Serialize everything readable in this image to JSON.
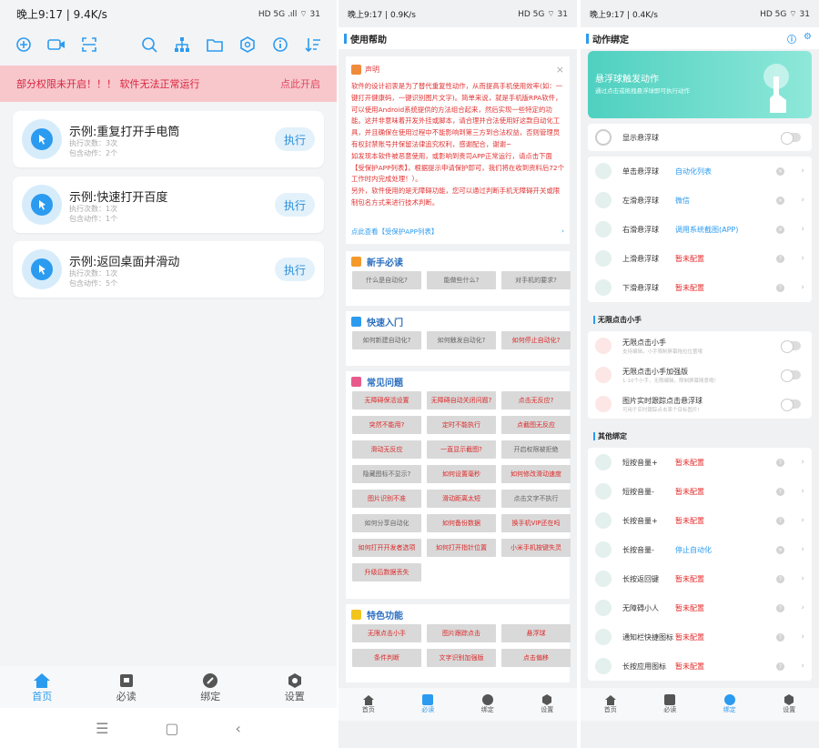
{
  "panel1": {
    "status": {
      "time": "晚上9:17 | 9.4K/s",
      "right": "HD 5G .ıll ⌔ 31"
    },
    "warning": {
      "text": "部分权限未开启！！！ 软件无法正常运行",
      "link": "点此开启"
    },
    "cards": [
      {
        "title": "示例:重复打开手电筒",
        "runs": "执行次数：3次",
        "actions": "包含动作：2个",
        "button": "执行"
      },
      {
        "title": "示例:快速打开百度",
        "runs": "执行次数：1次",
        "actions": "包含动作：1个",
        "button": "执行"
      },
      {
        "title": "示例:返回桌面并滑动",
        "runs": "执行次数：1次",
        "actions": "包含动作：5个",
        "button": "执行"
      }
    ],
    "tabs": [
      "首页",
      "必读",
      "绑定",
      "设置"
    ]
  },
  "panel2": {
    "status": {
      "time": "晚上9:17 | 0.9K/s",
      "right": "HD 5G ⌔ 31"
    },
    "title": "使用帮助",
    "notice": {
      "heading": "声明",
      "body": "软件的设计初衷是为了替代重复性动作，从而提高手机使用效率(如：一键打开健康码，一键识别图片文字)。简单来说，就是手机版RPA软件，可以使用Android系统提供的方法组合起来，然后实现一些特定的功能。这并非意味着开发外挂或脚本，请合理并合法使用好这款自动化工具，并且确保在使用过程中不能影响到第三方到合法权益，否则管理员有权封禁账号并保留法律追究权利，感谢配合，谢谢~\n如发现本软件被恶意使用，或影响到贵司APP正常运行，请点击下面【受保护APP列表】，根据提示申请保护即可，我们将在收到资料后72个工作时内完成处理！）。\n另外，软件使用的是无障碍功能，您可以通过判断手机无障碍开关或限制包名方式来进行技术判断。",
      "link": "点此查看【受保护APP列表】"
    },
    "sections": [
      {
        "title": "新手必读",
        "items": [
          {
            "t": "什么是自动化?",
            "r": false
          },
          {
            "t": "能做些什么?",
            "r": false
          },
          {
            "t": "对手机的要求?",
            "r": false
          }
        ]
      },
      {
        "title": "快速入门",
        "items": [
          {
            "t": "如何新建自动化?",
            "r": false
          },
          {
            "t": "如何触发自动化?",
            "r": false
          },
          {
            "t": "如何停止自动化?",
            "r": true
          }
        ]
      },
      {
        "title": "常见问题",
        "items": [
          {
            "t": "无障碍保活设置",
            "r": true
          },
          {
            "t": "无障碍自动关闭问题?",
            "r": true
          },
          {
            "t": "点击无反应?",
            "r": true
          },
          {
            "t": "突然不能用?",
            "r": true
          },
          {
            "t": "定时不能执行",
            "r": true
          },
          {
            "t": "点截图无反应",
            "r": true
          },
          {
            "t": "滑动无反应",
            "r": true
          },
          {
            "t": "一直显示截图?",
            "r": true
          },
          {
            "t": "开启权限被拒绝",
            "r": false
          },
          {
            "t": "隐藏图标不显示?",
            "r": false
          },
          {
            "t": "如何设置毫秒",
            "r": true
          },
          {
            "t": "如何修改滑动速度",
            "r": true
          },
          {
            "t": "图片识别不准",
            "r": true
          },
          {
            "t": "滑动距离太短",
            "r": true
          },
          {
            "t": "点击文字不执行",
            "r": false
          },
          {
            "t": "如何分享自动化",
            "r": false
          },
          {
            "t": "如何备份数据",
            "r": true
          },
          {
            "t": "换手机VIP还在吗",
            "r": true
          },
          {
            "t": "如何打开开发者选项",
            "r": true
          },
          {
            "t": "如何打开指针位置",
            "r": true
          },
          {
            "t": "小米手机按键失灵",
            "r": true
          },
          {
            "t": "升级后数据丢失",
            "r": true
          }
        ]
      },
      {
        "title": "特色功能",
        "items": [
          {
            "t": "无限点击小手",
            "r": true
          },
          {
            "t": "图片跟踪点击",
            "r": true
          },
          {
            "t": "悬浮球",
            "r": true
          },
          {
            "t": "条件判断",
            "r": true
          },
          {
            "t": "文字识别加强版",
            "r": true
          },
          {
            "t": "点击偏移",
            "r": true
          }
        ]
      }
    ],
    "tabs": [
      "首页",
      "必读",
      "绑定",
      "设置"
    ]
  },
  "panel3": {
    "status": {
      "time": "晚上9:17 | 0.4K/s",
      "right": "HD 5G ⌔ 31"
    },
    "title": "动作绑定",
    "hero": {
      "title": "悬浮球触发动作",
      "sub": "通过点击或拖拽悬浮球即可执行动作"
    },
    "show_ball": "显示悬浮球",
    "ball_rows": [
      {
        "l": "单击悬浮球",
        "v": "自动化列表",
        "b": true
      },
      {
        "l": "左滑悬浮球",
        "v": "微信",
        "b": true
      },
      {
        "l": "右滑悬浮球",
        "v": "调用系统截图(APP)",
        "b": true
      },
      {
        "l": "上滑悬浮球",
        "v": "暂未配置",
        "b": false
      },
      {
        "l": "下滑悬浮球",
        "v": "暂未配置",
        "b": false
      }
    ],
    "infinite_title": "无限点击小手",
    "infinite_rows": [
      {
        "l": "无限点击小手",
        "s": "支持编辑，小手限制屏幕拖拉位置哦"
      },
      {
        "l": "无限点击小手加强版",
        "s": "1-10个小手，无限编辑，限制屏幕随意哦！"
      },
      {
        "l": "图片实时跟踪点击悬浮球",
        "s": "可用于实时跟踪点击某个目标图片!"
      }
    ],
    "other_title": "其他绑定",
    "other_rows": [
      {
        "l": "短按音量+",
        "v": "暂未配置",
        "b": false
      },
      {
        "l": "短按音量-",
        "v": "暂未配置",
        "b": false
      },
      {
        "l": "长按音量+",
        "v": "暂未配置",
        "b": false
      },
      {
        "l": "长按音量-",
        "v": "停止自动化",
        "b": true
      },
      {
        "l": "长按返回键",
        "v": "暂未配置",
        "b": false
      },
      {
        "l": "无障碍小人",
        "v": "暂未配置",
        "b": false
      },
      {
        "l": "通知栏快捷图标",
        "v": "暂未配置",
        "b": false
      },
      {
        "l": "长按应用图标",
        "v": "暂未配置",
        "b": false
      }
    ],
    "tabs": [
      "首页",
      "必读",
      "绑定",
      "设置"
    ]
  }
}
